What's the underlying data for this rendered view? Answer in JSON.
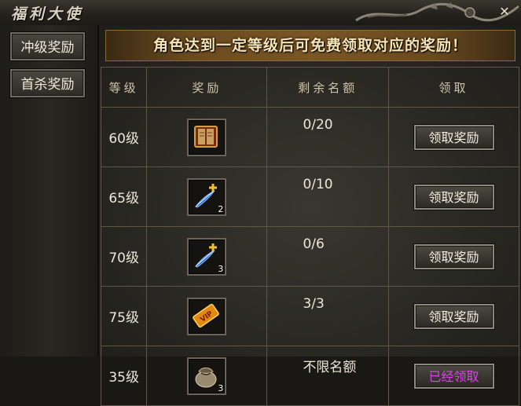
{
  "window": {
    "title": "福利大使",
    "close_glyph": "✕"
  },
  "sidebar": {
    "items": [
      {
        "label": "冲级奖励"
      },
      {
        "label": "首杀奖励"
      }
    ]
  },
  "banner": {
    "text": "角色达到一定等级后可免费领取对应的奖励！"
  },
  "table": {
    "headers": {
      "level": "等级",
      "reward": "奖励",
      "quota": "剩余名额",
      "claim": "领取"
    },
    "rows": [
      {
        "level": "60级",
        "reward_icon": "book-icon",
        "reward_count": "",
        "quota": "0/20",
        "claim": "领取奖励",
        "claimed": false
      },
      {
        "level": "65级",
        "reward_icon": "feather-plus-icon",
        "reward_count": "2",
        "quota": "0/10",
        "claim": "领取奖励",
        "claimed": false
      },
      {
        "level": "70级",
        "reward_icon": "feather-plus-icon",
        "reward_count": "3",
        "quota": "0/6",
        "claim": "领取奖励",
        "claimed": false
      },
      {
        "level": "75级",
        "reward_icon": "vip-card-icon",
        "reward_count": "",
        "quota": "3/3",
        "claim": "领取奖励",
        "claimed": false
      },
      {
        "level": "35级",
        "reward_icon": "pouch-icon",
        "reward_count": "3",
        "quota": "不限名额",
        "claim": "已经领取",
        "claimed": true
      }
    ]
  },
  "colors": {
    "claimed_text": "#e040ee",
    "banner_text": "#f6e4b4"
  }
}
